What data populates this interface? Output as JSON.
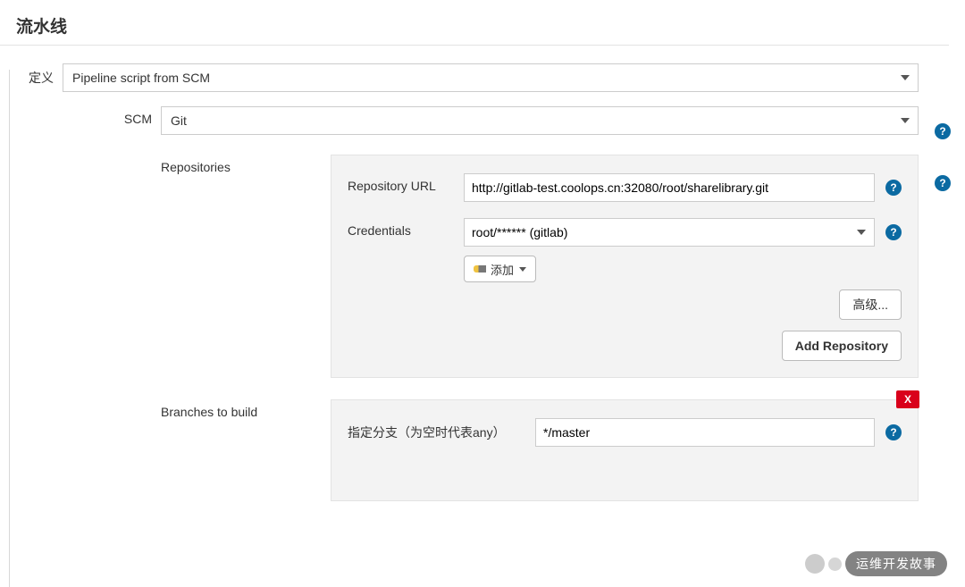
{
  "section_title": "流水线",
  "definition": {
    "label": "定义",
    "value": "Pipeline script from SCM"
  },
  "scm": {
    "label": "SCM",
    "value": "Git"
  },
  "repositories": {
    "label": "Repositories",
    "repo_url_label": "Repository URL",
    "repo_url_value": "http://gitlab-test.coolops.cn:32080/root/sharelibrary.git",
    "credentials_label": "Credentials",
    "credentials_value": "root/****** (gitlab)",
    "add_credentials_label": "添加",
    "advanced_label": "高级...",
    "add_repo_label": "Add Repository"
  },
  "branches": {
    "label": "Branches to build",
    "branch_spec_label": "指定分支（为空时代表any）",
    "branch_spec_value": "*/master",
    "delete_label": "X"
  },
  "watermark": "运维开发故事",
  "help_glyph": "?"
}
